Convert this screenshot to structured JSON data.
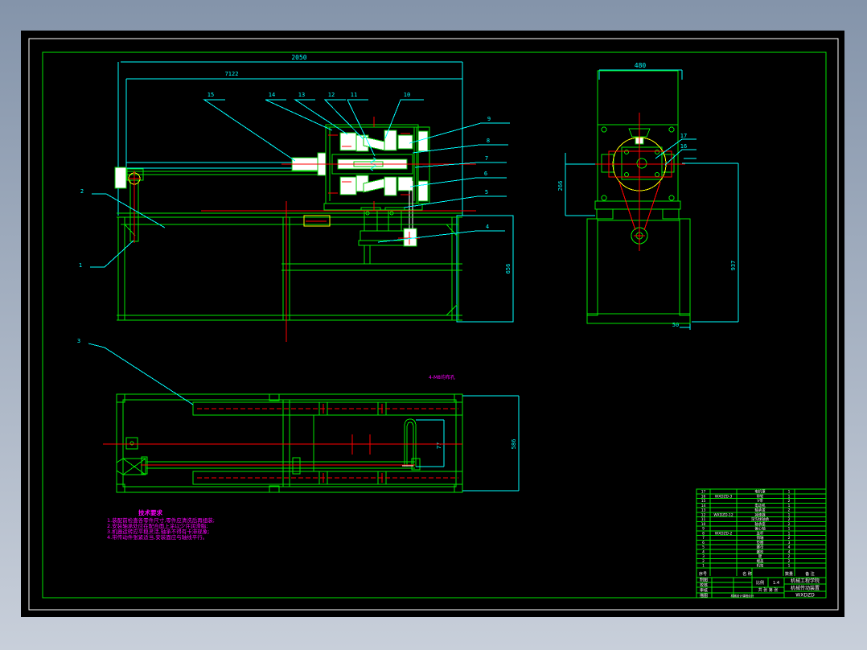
{
  "window": {
    "background_top": "#8494aa",
    "background_bottom": "#c8cfda",
    "canvas_color": "#000000"
  },
  "colors": {
    "outline_green": "#00e400",
    "dimension_cyan": "#00ffff",
    "centerline_red": "#ff0000",
    "highlight_yellow": "#ffff00",
    "notes_magenta": "#ff00ff",
    "table_text_white": "#ffffff"
  },
  "dims": {
    "front_top_width": "2050",
    "front_inner_width": "7122",
    "front_height": "656",
    "side_top_width": "480",
    "side_left_height": "266",
    "side_right_height": "937",
    "side_foot": "50",
    "top_view_height": "586",
    "top_view_slot": "77"
  },
  "part_labels": [
    "1",
    "2",
    "3",
    "4",
    "5",
    "6",
    "7",
    "8",
    "9",
    "10",
    "11",
    "12",
    "13",
    "14",
    "15",
    "16",
    "17"
  ],
  "annotation": "4-M8均布孔",
  "notes": {
    "title": "技术要求",
    "lines": [
      "1.装配前检查各零件尺寸,零件应清洗后再组装;",
      "2.安装轴承处应在配合面上涂以少许润滑脂;",
      "3.机器运转应平稳灵活,轴承不得有卡滞现象;",
      "4.带传动件张紧适当,安装面应与轴线平行。"
    ]
  },
  "bom": {
    "headers": [
      "序号",
      "名  称",
      "数量",
      "备 注"
    ],
    "rows": [
      {
        "no": "17",
        "code": "",
        "name": "电机罩",
        "qty": "1",
        "remark": ""
      },
      {
        "no": "16",
        "code": "WXDZD-3",
        "name": "带轮",
        "qty": "1",
        "remark": ""
      },
      {
        "no": "15",
        "code": "",
        "name": "V带",
        "qty": "2",
        "remark": ""
      },
      {
        "no": "14",
        "code": "",
        "name": "电动机",
        "qty": "1",
        "remark": ""
      },
      {
        "no": "13",
        "code": "",
        "name": "轴承盖",
        "qty": "2",
        "remark": ""
      },
      {
        "no": "12",
        "code": "WXDZD-12",
        "name": "减速器",
        "qty": "1",
        "remark": ""
      },
      {
        "no": "11",
        "code": "",
        "name": "深沟球轴承",
        "qty": "2",
        "remark": ""
      },
      {
        "no": "10",
        "code": "",
        "name": "轴承座",
        "qty": "2",
        "remark": ""
      },
      {
        "no": "9",
        "code": "",
        "name": "偏心轴",
        "qty": "1",
        "remark": ""
      },
      {
        "no": "8",
        "code": "WXDZD-2",
        "name": "连杆",
        "qty": "1",
        "remark": ""
      },
      {
        "no": "7",
        "code": "",
        "name": "销轴",
        "qty": "2",
        "remark": ""
      },
      {
        "no": "6",
        "code": "",
        "name": "垫圈",
        "qty": "3",
        "remark": ""
      },
      {
        "no": "5",
        "code": "",
        "name": "螺母",
        "qty": "4",
        "remark": ""
      },
      {
        "no": "4",
        "code": "",
        "name": "螺栓",
        "qty": "4",
        "remark": ""
      },
      {
        "no": "3",
        "code": "",
        "name": "键",
        "qty": "2",
        "remark": ""
      },
      {
        "no": "2",
        "code": "",
        "name": "端盖",
        "qty": "2",
        "remark": ""
      },
      {
        "no": "1",
        "code": "",
        "name": "机架",
        "qty": "1",
        "remark": ""
      }
    ]
  },
  "titleblock": {
    "sign_labels": [
      "制图",
      "校核",
      "审核",
      "描图"
    ],
    "project": "机械设计课程设计",
    "scale_label": "比例",
    "scale_value": "1:4",
    "sheets": "共 张 第 张",
    "org": "机械工程学院",
    "product": "机械传动装置",
    "number": "WXDZD"
  }
}
